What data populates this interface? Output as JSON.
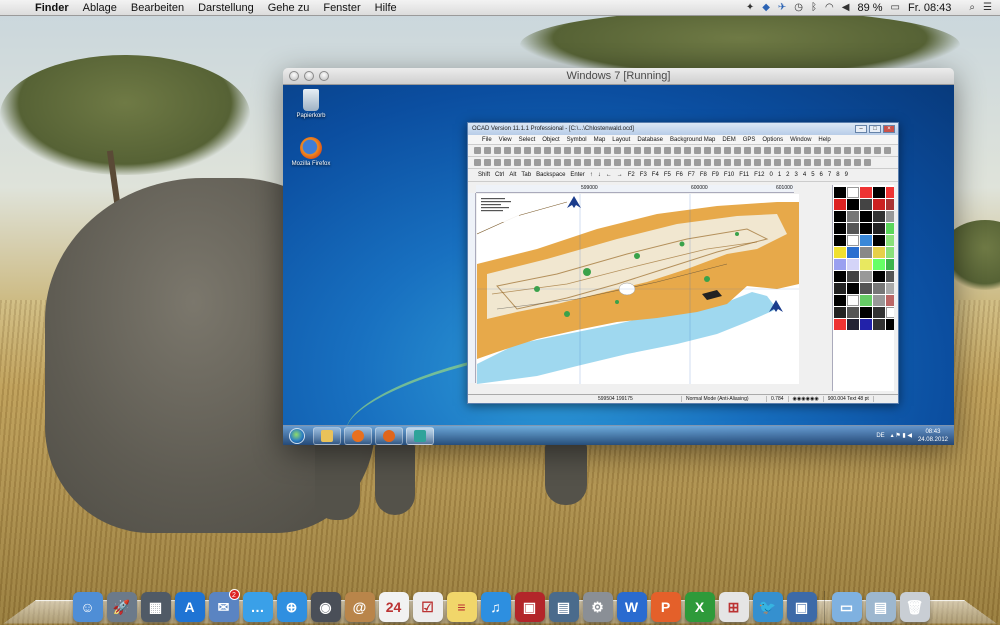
{
  "menubar": {
    "apple_icon": "apple-logo-icon",
    "app_name": "Finder",
    "menus": [
      "Ablage",
      "Bearbeiten",
      "Darstellung",
      "Gehe zu",
      "Fenster",
      "Hilfe"
    ],
    "battery": "89 %",
    "clock": "Fr. 08:43",
    "status_icons": [
      "wand-icon",
      "dropbox-icon",
      "twitter-icon",
      "time-machine-icon",
      "bluetooth-icon",
      "wifi-icon",
      "volume-icon",
      "battery-icon"
    ]
  },
  "vm_window": {
    "title": "Windows 7 [Running]"
  },
  "win_desktop": {
    "icons": [
      {
        "label": "Papierkorb",
        "icon": "recycle-bin-icon"
      },
      {
        "label": "Mozilla Firefox",
        "icon": "firefox-icon"
      }
    ],
    "taskbar": {
      "tray_lang": "DE",
      "time": "08:43",
      "date": "24.08.2012"
    }
  },
  "ocad": {
    "title": "OCAD Version 11.1.1  Professional - [C:\\...\\Chlostenwald.ocd]",
    "menus": [
      "File",
      "View",
      "Select",
      "Object",
      "Symbol",
      "Map",
      "Layout",
      "Database",
      "Background Map",
      "DEM",
      "GPS",
      "Options",
      "Window",
      "Help"
    ],
    "keys": [
      "Shift",
      "Ctrl",
      "Alt",
      "Tab",
      "Backspace",
      "Enter",
      "↑",
      "↓",
      "←",
      "→",
      "F2",
      "F3",
      "F4",
      "F5",
      "F6",
      "F7",
      "F8",
      "F9",
      "F10",
      "F11",
      "F12",
      "0",
      "1",
      "2",
      "3",
      "4",
      "5",
      "6",
      "7",
      "8",
      "9"
    ],
    "ruler": [
      "599000",
      "600000",
      "601000"
    ],
    "status": {
      "coords": "599504  199175",
      "mode": "Normal Mode (Anti-Aliasing)",
      "zoom": "0.784",
      "symbol": "900.004 Text 48 pt"
    }
  },
  "dock": {
    "apps": [
      {
        "name": "finder-icon",
        "color": "#4f8ed6",
        "glyph": "☺"
      },
      {
        "name": "launchpad-icon",
        "color": "#6c7a8a",
        "glyph": "🚀"
      },
      {
        "name": "dashboard-icon",
        "color": "#505a66",
        "glyph": "▦"
      },
      {
        "name": "app-store-icon",
        "color": "#1f74d4",
        "glyph": "A"
      },
      {
        "name": "mail-icon",
        "color": "#5a84c2",
        "glyph": "✉",
        "badge": "2"
      },
      {
        "name": "messages-icon",
        "color": "#3aa0e8",
        "glyph": "…"
      },
      {
        "name": "safari-icon",
        "color": "#2f8fe0",
        "glyph": "⊕"
      },
      {
        "name": "facetime-icon",
        "color": "#4a4f58",
        "glyph": "◉"
      },
      {
        "name": "contacts-icon",
        "color": "#b9854a",
        "glyph": "@"
      },
      {
        "name": "calendar-icon",
        "color": "#f2f2f2",
        "glyph": "24"
      },
      {
        "name": "reminders-icon",
        "color": "#ededed",
        "glyph": "☑"
      },
      {
        "name": "notes-icon",
        "color": "#f1d66a",
        "glyph": "≡"
      },
      {
        "name": "itunes-icon",
        "color": "#2d8fe0",
        "glyph": "♫"
      },
      {
        "name": "photo-booth-icon",
        "color": "#b3262a",
        "glyph": "▣"
      },
      {
        "name": "iphoto-icon",
        "color": "#4a6b8c",
        "glyph": "▤"
      },
      {
        "name": "system-preferences-icon",
        "color": "#8a8f96",
        "glyph": "⚙"
      },
      {
        "name": "word-icon",
        "color": "#2a6bd0",
        "glyph": "W"
      },
      {
        "name": "powerpoint-icon",
        "color": "#e4602a",
        "glyph": "P"
      },
      {
        "name": "excel-icon",
        "color": "#2e9a3a",
        "glyph": "X"
      },
      {
        "name": "windows-icon",
        "color": "#e5e5e5",
        "glyph": "⊞"
      },
      {
        "name": "twitter-icon",
        "color": "#3590cf",
        "glyph": "🐦"
      },
      {
        "name": "virtualbox-icon",
        "color": "#3d6aa8",
        "glyph": "▣"
      }
    ],
    "right": [
      {
        "name": "applications-folder-icon",
        "color": "#7fb1e0",
        "glyph": "▭"
      },
      {
        "name": "downloads-stack-icon",
        "color": "#9db7cf",
        "glyph": "▤"
      },
      {
        "name": "trash-icon",
        "color": "#c9ced4",
        "glyph": "🗑"
      }
    ]
  }
}
